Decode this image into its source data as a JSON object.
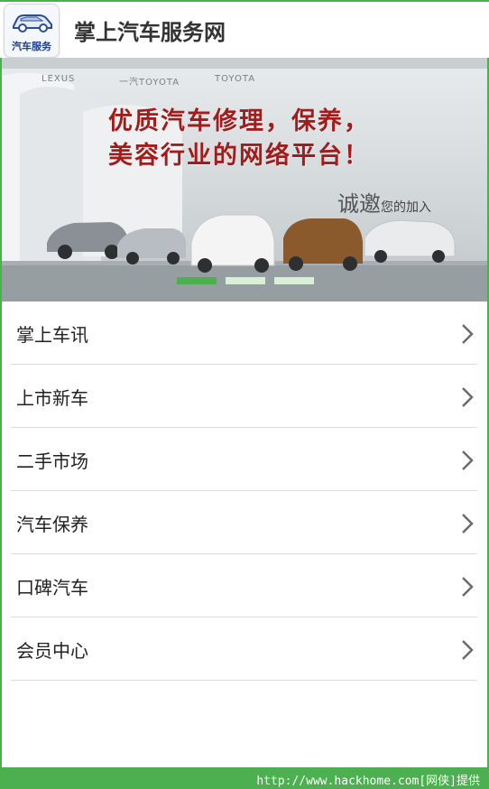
{
  "header": {
    "logo_text": "汽车服务",
    "title": "掌上汽车服务网"
  },
  "banner": {
    "brands": [
      "LEXUS",
      "一汽TOYOTA",
      "TOYOTA"
    ],
    "headline_line1": "优质汽车修理，保养，",
    "headline_line2": "美容行业的网络平台！",
    "invite_big": "诚邀",
    "invite_small": "您的加入",
    "pager": {
      "total": 3,
      "active_index": 0
    }
  },
  "menu": {
    "items": [
      {
        "label": "掌上车讯"
      },
      {
        "label": "上市新车"
      },
      {
        "label": "二手市场"
      },
      {
        "label": "汽车保养"
      },
      {
        "label": "口碑汽车"
      },
      {
        "label": "会员中心"
      }
    ]
  },
  "footer": {
    "link_text": "http://www.hackhome.com[网侠]提供"
  },
  "colors": {
    "accent": "#4caf50",
    "headline": "#a31c1c",
    "text": "#222222"
  }
}
